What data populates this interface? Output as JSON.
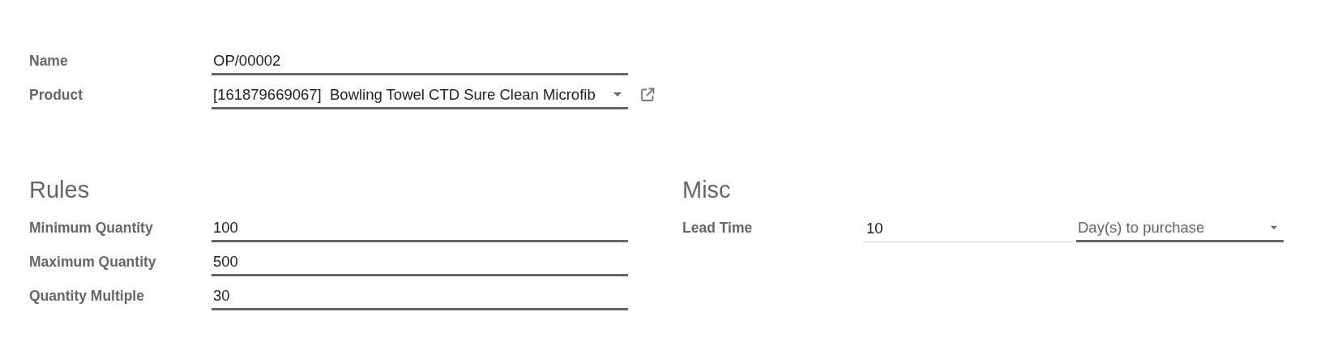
{
  "header_fields": [
    {
      "label": "Name",
      "kind": "text",
      "value": "OP/00002",
      "required": true
    },
    {
      "label": "Product",
      "kind": "select",
      "value": "[161879669067]  Bowling Towel CTD Sure Clean Microfib",
      "required": true,
      "external_link": true
    }
  ],
  "rules": {
    "title": "Rules",
    "fields": [
      {
        "label": "Minimum Quantity",
        "value": "100",
        "required": true
      },
      {
        "label": "Maximum Quantity",
        "value": "500",
        "required": true
      },
      {
        "label": "Quantity Multiple",
        "value": "30",
        "required": true
      }
    ]
  },
  "misc": {
    "title": "Misc",
    "lead_time": {
      "label": "Lead Time",
      "value": "10",
      "required": false,
      "unit": {
        "value": "Day(s) to purchase",
        "required": true
      }
    }
  }
}
